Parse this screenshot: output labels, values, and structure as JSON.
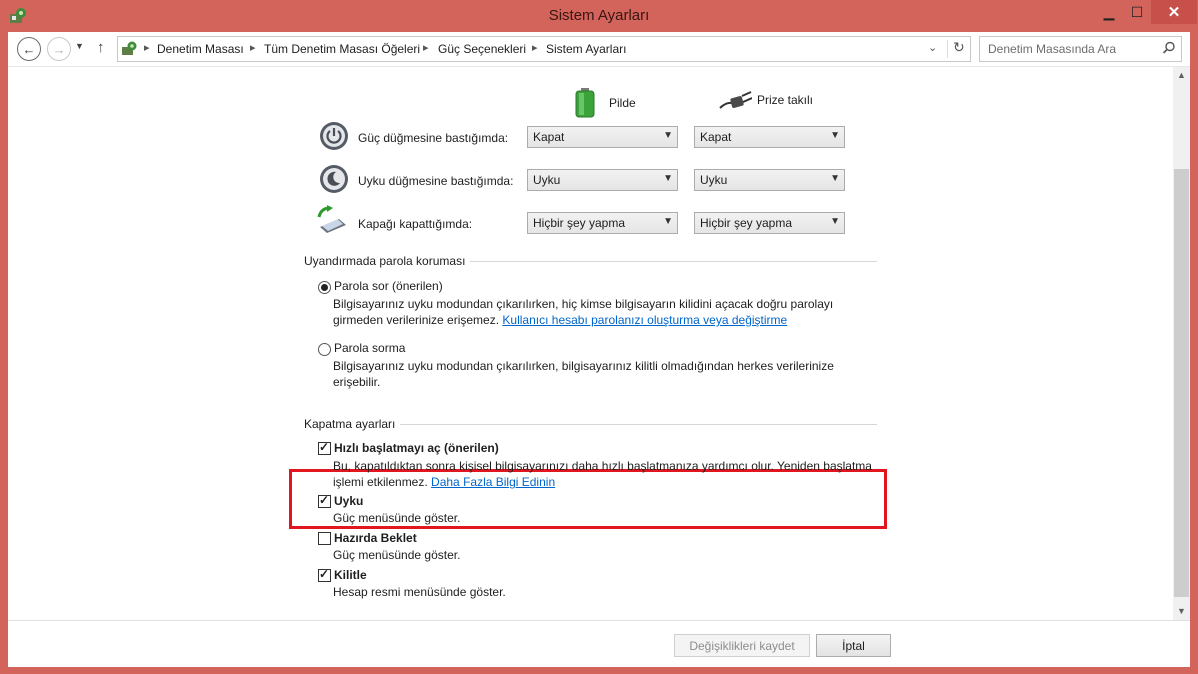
{
  "window": {
    "title": "Sistem Ayarları"
  },
  "nav": {
    "breadcrumbs": [
      "Denetim Masası",
      "Tüm Denetim Masası Öğeleri",
      "Güç Seçenekleri",
      "Sistem Ayarları"
    ],
    "search_placeholder": "Denetim Masasında Ara"
  },
  "power_buttons": {
    "col_battery": "Pilde",
    "col_plugged": "Prize takılı",
    "rows": [
      {
        "label": "Güç düğmesine bastığımda:",
        "battery": "Kapat",
        "plugged": "Kapat"
      },
      {
        "label": "Uyku düğmesine bastığımda:",
        "battery": "Uyku",
        "plugged": "Uyku"
      },
      {
        "label": "Kapağı kapattığımda:",
        "battery": "Hiçbir şey yapma",
        "plugged": "Hiçbir şey yapma"
      }
    ]
  },
  "password_group": {
    "title": "Uyandırmada parola koruması",
    "opt1_label": "Parola sor (önerilen)",
    "opt1_desc1": "Bilgisayarınız uyku modundan çıkarılırken, hiç kimse bilgisayarın kilidini açacak doğru parolayı",
    "opt1_desc2": "girmeden verilerinize erişemez.",
    "opt1_link": "Kullanıcı hesabı parolanızı oluşturma veya değiştirme",
    "opt2_label": "Parola sorma",
    "opt2_desc1": "Bilgisayarınız uyku modundan çıkarılırken, bilgisayarınız kilitli olmadığından herkes verilerinize",
    "opt2_desc2": "erişebilir."
  },
  "shutdown_group": {
    "title": "Kapatma ayarları",
    "fast_label": "Hızlı başlatmayı aç (önerilen)",
    "fast_desc1": "Bu, kapatıldıktan sonra kişisel bilgisayarınızı daha hızlı başlatmanıza yardımcı olur. Yeniden başlatma",
    "fast_desc2": "işlemi etkilenmez.",
    "fast_link": "Daha Fazla Bilgi Edinin",
    "sleep_label": "Uyku",
    "sleep_desc": "Güç menüsünde göster.",
    "hibernate_label": "Hazırda Beklet",
    "hibernate_desc": "Güç menüsünde göster.",
    "lock_label": "Kilitle",
    "lock_desc": "Hesap resmi menüsünde göster."
  },
  "footer": {
    "save_label": "Değişiklikleri kaydet",
    "cancel_label": "İptal"
  }
}
